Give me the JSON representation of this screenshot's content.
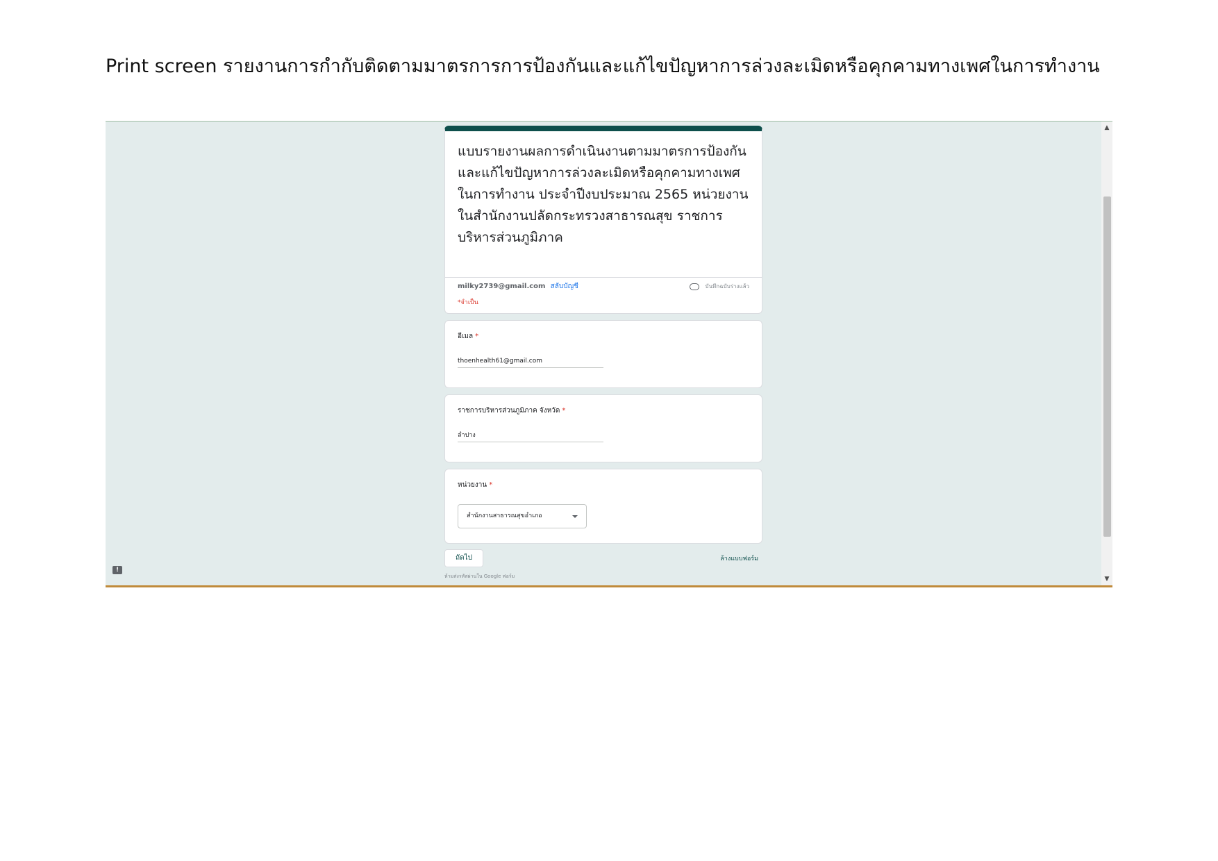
{
  "document": {
    "heading": "Print screen รายงานการกำกับติดตามมาตรการการป้องกันและแก้ไขปัญหาการล่วงละเมิดหรือคุกคามทางเพศในการทำงาน"
  },
  "form": {
    "title": "แบบรายงานผลการดำเนินงานตามมาตรการป้องกันและแก้ไขปัญหาการล่วงละเมิดหรือคุกคามทางเพศในการทำงาน ประจำปีงบประมาณ 2565 หน่วยงานในสำนักงานปลัดกระทรวงสาธารณสุข ราชการบริหารส่วนภูมิภาค",
    "account_email": "milky2739@gmail.com",
    "switch_account_label": "สลับบัญชี",
    "draft_status": "บันทึกฉบับร่างแล้ว",
    "required_note": "*จำเป็น",
    "questions": [
      {
        "label": "อีเมล",
        "required_mark": "*",
        "value": "thoenhealth61@gmail.com"
      },
      {
        "label": "ราชการบริหารส่วนภูมิภาค จังหวัด",
        "required_mark": "*",
        "value": "ลำปาง"
      },
      {
        "label": "หน่วยงาน",
        "required_mark": "*",
        "selected": "สำนักงานสาธารณสุขอำเภอ"
      }
    ],
    "next_button": "ถัดไป",
    "clear_form_link": "ล้างแบบฟอร์ม",
    "footer_note": "ห้ามส่งรหัสผ่านใน Google ฟอร์ม"
  },
  "icons": {
    "cloud": "cloud-icon",
    "dropdown": "chevron-down-icon",
    "feedback": "feedback-icon",
    "scroll_up": "scroll-up-icon",
    "scroll_down": "scroll-down-icon"
  },
  "colors": {
    "theme": "#0e4f4c",
    "background": "#e3ecec",
    "required": "#d93025",
    "link": "#1a73e8"
  }
}
